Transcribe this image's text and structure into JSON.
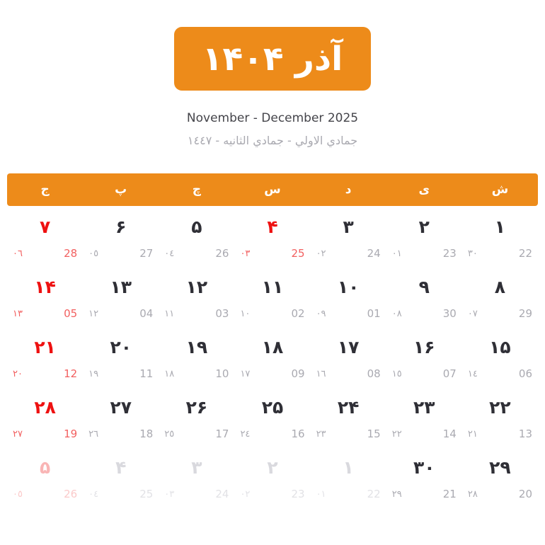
{
  "header": {
    "title": "آذر ۱۴۰۴",
    "gregorian_range": "November - December 2025",
    "hijri_range": "جمادي الاولي - جمادي الثانيه - ١٤٤٧",
    "accent_color": "#ED8B1A",
    "holiday_color": "#EE1111",
    "text_color": "#2F2F36",
    "muted_color": "#AAAAB1"
  },
  "weekdays": [
    {
      "label": "ش",
      "name": "shanbeh"
    },
    {
      "label": "ی",
      "name": "yekshanbeh"
    },
    {
      "label": "د",
      "name": "doshanbeh"
    },
    {
      "label": "س",
      "name": "seshanbeh"
    },
    {
      "label": "چ",
      "name": "chaharshanbeh"
    },
    {
      "label": "پ",
      "name": "panjshanbeh"
    },
    {
      "label": "ج",
      "name": "jomeh"
    }
  ],
  "weeks": [
    {
      "days": [
        {
          "persian": "۱",
          "gregorian": "22",
          "hijri": "٣٠",
          "holiday": false,
          "other_month": false
        },
        {
          "persian": "۲",
          "gregorian": "23",
          "hijri": "٠١",
          "holiday": false,
          "other_month": false
        },
        {
          "persian": "۳",
          "gregorian": "24",
          "hijri": "٠٢",
          "holiday": false,
          "other_month": false
        },
        {
          "persian": "۴",
          "gregorian": "25",
          "hijri": "٠٣",
          "holiday": true,
          "other_month": false
        },
        {
          "persian": "۵",
          "gregorian": "26",
          "hijri": "٠٤",
          "holiday": false,
          "other_month": false
        },
        {
          "persian": "۶",
          "gregorian": "27",
          "hijri": "٠٥",
          "holiday": false,
          "other_month": false
        },
        {
          "persian": "۷",
          "gregorian": "28",
          "hijri": "٠٦",
          "holiday": true,
          "other_month": false
        }
      ]
    },
    {
      "days": [
        {
          "persian": "۸",
          "gregorian": "29",
          "hijri": "٠٧",
          "holiday": false,
          "other_month": false
        },
        {
          "persian": "۹",
          "gregorian": "30",
          "hijri": "٠٨",
          "holiday": false,
          "other_month": false
        },
        {
          "persian": "۱۰",
          "gregorian": "01",
          "hijri": "٠٩",
          "holiday": false,
          "other_month": false
        },
        {
          "persian": "۱۱",
          "gregorian": "02",
          "hijri": "١٠",
          "holiday": false,
          "other_month": false
        },
        {
          "persian": "۱۲",
          "gregorian": "03",
          "hijri": "١١",
          "holiday": false,
          "other_month": false
        },
        {
          "persian": "۱۳",
          "gregorian": "04",
          "hijri": "١٢",
          "holiday": false,
          "other_month": false
        },
        {
          "persian": "۱۴",
          "gregorian": "05",
          "hijri": "١٣",
          "holiday": true,
          "other_month": false
        }
      ]
    },
    {
      "days": [
        {
          "persian": "۱۵",
          "gregorian": "06",
          "hijri": "١٤",
          "holiday": false,
          "other_month": false
        },
        {
          "persian": "۱۶",
          "gregorian": "07",
          "hijri": "١٥",
          "holiday": false,
          "other_month": false
        },
        {
          "persian": "۱۷",
          "gregorian": "08",
          "hijri": "١٦",
          "holiday": false,
          "other_month": false
        },
        {
          "persian": "۱۸",
          "gregorian": "09",
          "hijri": "١٧",
          "holiday": false,
          "other_month": false
        },
        {
          "persian": "۱۹",
          "gregorian": "10",
          "hijri": "١٨",
          "holiday": false,
          "other_month": false
        },
        {
          "persian": "۲۰",
          "gregorian": "11",
          "hijri": "١٩",
          "holiday": false,
          "other_month": false
        },
        {
          "persian": "۲۱",
          "gregorian": "12",
          "hijri": "٢٠",
          "holiday": true,
          "other_month": false
        }
      ]
    },
    {
      "days": [
        {
          "persian": "۲۲",
          "gregorian": "13",
          "hijri": "٢١",
          "holiday": false,
          "other_month": false
        },
        {
          "persian": "۲۳",
          "gregorian": "14",
          "hijri": "٢٢",
          "holiday": false,
          "other_month": false
        },
        {
          "persian": "۲۴",
          "gregorian": "15",
          "hijri": "٢٣",
          "holiday": false,
          "other_month": false
        },
        {
          "persian": "۲۵",
          "gregorian": "16",
          "hijri": "٢٤",
          "holiday": false,
          "other_month": false
        },
        {
          "persian": "۲۶",
          "gregorian": "17",
          "hijri": "٢٥",
          "holiday": false,
          "other_month": false
        },
        {
          "persian": "۲۷",
          "gregorian": "18",
          "hijri": "٢٦",
          "holiday": false,
          "other_month": false
        },
        {
          "persian": "۲۸",
          "gregorian": "19",
          "hijri": "٢٧",
          "holiday": true,
          "other_month": false
        }
      ]
    },
    {
      "days": [
        {
          "persian": "۲۹",
          "gregorian": "20",
          "hijri": "٢٨",
          "holiday": false,
          "other_month": false
        },
        {
          "persian": "۳۰",
          "gregorian": "21",
          "hijri": "٢٩",
          "holiday": false,
          "other_month": false
        },
        {
          "persian": "۱",
          "gregorian": "22",
          "hijri": "٠١",
          "holiday": false,
          "other_month": true
        },
        {
          "persian": "۲",
          "gregorian": "23",
          "hijri": "٠٢",
          "holiday": false,
          "other_month": true
        },
        {
          "persian": "۳",
          "gregorian": "24",
          "hijri": "٠٣",
          "holiday": false,
          "other_month": true
        },
        {
          "persian": "۴",
          "gregorian": "25",
          "hijri": "٠٤",
          "holiday": false,
          "other_month": true
        },
        {
          "persian": "۵",
          "gregorian": "26",
          "hijri": "٠٥",
          "holiday": true,
          "other_month": true
        }
      ]
    }
  ]
}
